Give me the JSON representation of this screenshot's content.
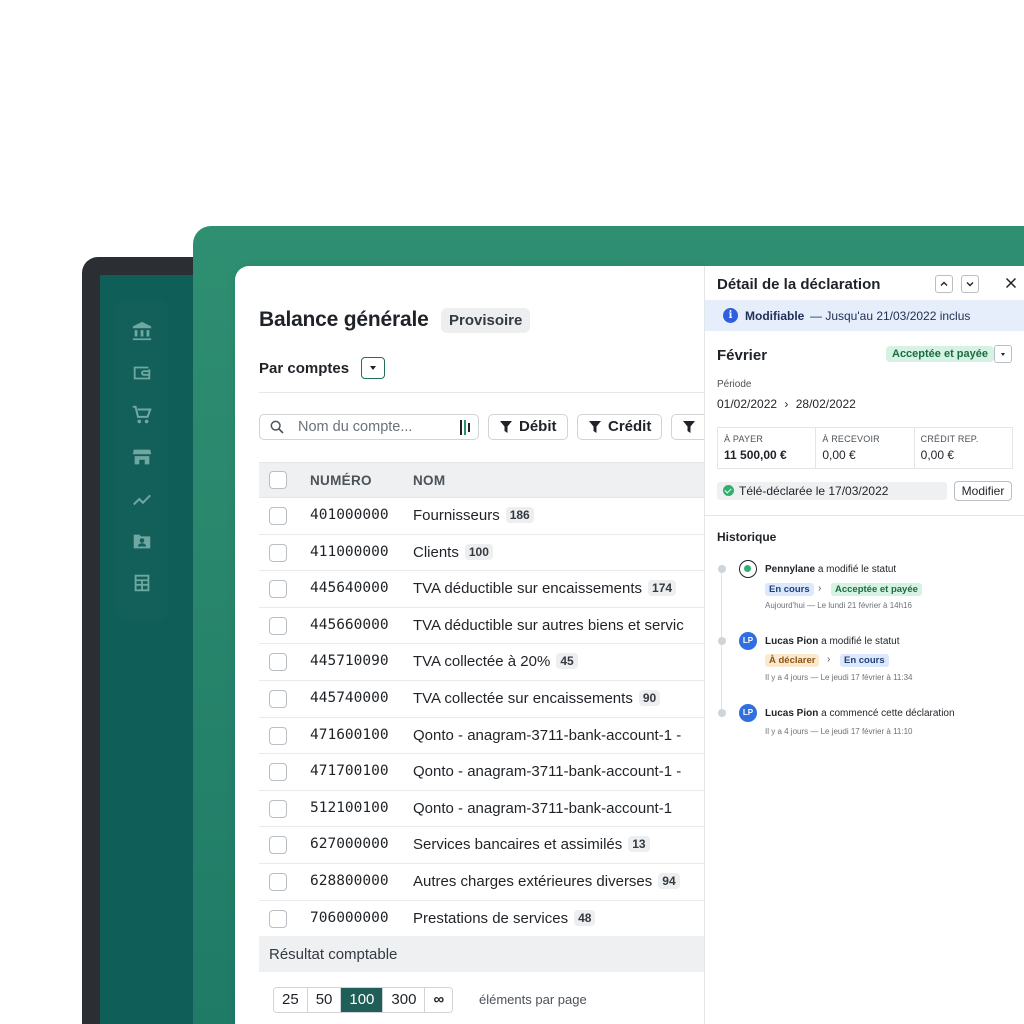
{
  "sidebar": {
    "icons": [
      "bank-icon",
      "wallet-icon",
      "cart-icon",
      "store-icon",
      "trend-icon",
      "folder-user-icon",
      "spreadsheet-icon"
    ]
  },
  "main": {
    "title": "Balance générale",
    "badge": "Provisoire",
    "group_label": "Par comptes",
    "search_placeholder": "Nom du compte...",
    "filters": [
      "Débit",
      "Crédit"
    ],
    "columns": [
      "NUMÉRO",
      "NOM"
    ],
    "rows": [
      {
        "num": "401000000",
        "nom": "Fournisseurs",
        "count": "186"
      },
      {
        "num": "411000000",
        "nom": "Clients",
        "count": "100"
      },
      {
        "num": "445640000",
        "nom": "TVA déductible sur encaissements",
        "count": "174"
      },
      {
        "num": "445660000",
        "nom": "TVA déductible sur autres biens et servic",
        "count": ""
      },
      {
        "num": "445710090",
        "nom": "TVA collectée à 20%",
        "count": "45"
      },
      {
        "num": "445740000",
        "nom": "TVA collectée sur encaissements",
        "count": "90"
      },
      {
        "num": "471600100",
        "nom": "Qonto - anagram-3711-bank-account-1 -",
        "count": ""
      },
      {
        "num": "471700100",
        "nom": "Qonto - anagram-3711-bank-account-1 -",
        "count": ""
      },
      {
        "num": "512100100",
        "nom": "Qonto - anagram-3711-bank-account-1",
        "count": ""
      },
      {
        "num": "627000000",
        "nom": "Services bancaires et assimilés",
        "count": "13"
      },
      {
        "num": "628800000",
        "nom": "Autres charges extérieures diverses",
        "count": "94"
      },
      {
        "num": "706000000",
        "nom": "Prestations de services",
        "count": "48"
      }
    ],
    "resultat_label": "Résultat comptable",
    "page_sizes": [
      "25",
      "50",
      "100",
      "300",
      "∞"
    ],
    "active_page_size": "100",
    "per_page_label": "éléments par page"
  },
  "panel": {
    "title": "Détail de la déclaration",
    "modifiable_label": "Modifiable",
    "modifiable_until": "—  Jusqu'au 21/03/2022 inclus",
    "month": "Février",
    "status": "Acceptée et payée",
    "periode_label": "Période",
    "periode_start": "01/02/2022",
    "periode_end": "28/02/2022",
    "amounts": [
      {
        "label": "À PAYER",
        "value": "11 500,00 €"
      },
      {
        "label": "À RECEVOIR",
        "value": "0,00 €"
      },
      {
        "label": "CRÉDIT REP.",
        "value": "0,00 €"
      }
    ],
    "tele_label": "Télé-déclarée le 17/03/2022",
    "modifier_label": "Modifier",
    "historique_title": "Historique",
    "history": [
      {
        "actor": "Pennylane",
        "action": "a modifié le statut",
        "from": "En cours",
        "to": "Acceptée et payée",
        "time": "Aujourd'hui — Le lundi 21 février à 14h16"
      },
      {
        "actor": "Lucas Pion",
        "initials": "LP",
        "action": "a modifié le statut",
        "from": "À déclarer",
        "to": "En cours",
        "time": "Il y a 4 jours — Le jeudi 17 février à 11:34"
      },
      {
        "actor": "Lucas Pion",
        "initials": "LP",
        "action": "a commencé cette déclaration",
        "time": "Il y a 4 jours — Le jeudi 17 février à 11:10"
      }
    ]
  },
  "colors": {
    "brand_green": "#1f7a66",
    "sidebar_teal": "#0f5e58",
    "accent_blue": "#2f5fe0",
    "success_green": "#2fb070"
  }
}
